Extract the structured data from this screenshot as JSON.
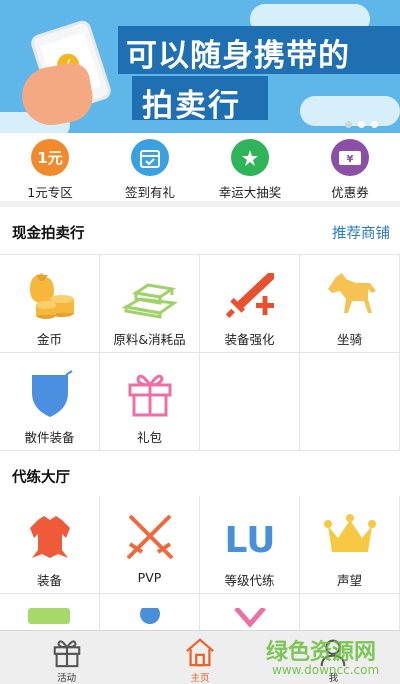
{
  "banner": {
    "headline_line1": "可以随身携带的",
    "headline_line2": "拍卖行",
    "page_dots": 3,
    "active_dot": 2
  },
  "quick_menu": [
    {
      "label": "1元专区",
      "icon": "one-yuan-icon",
      "icon_text": "1元",
      "color": "#f08a2c"
    },
    {
      "label": "签到有礼",
      "icon": "calendar-checkin-icon",
      "icon_text": "",
      "color": "#3aa0df"
    },
    {
      "label": "幸运大抽奖",
      "icon": "lucky-draw-icon",
      "icon_text": "",
      "color": "#2fb45a"
    },
    {
      "label": "优惠券",
      "icon": "coupon-icon",
      "icon_text": "",
      "color": "#8b4fa8"
    }
  ],
  "cash_auction": {
    "title": "现金拍卖行",
    "link": "推荐商铺",
    "items": [
      {
        "label": "金币",
        "icon": "gold-coins-icon"
      },
      {
        "label": "原料&消耗品",
        "icon": "gold-bars-icon"
      },
      {
        "label": "装备强化",
        "icon": "sword-plus-icon"
      },
      {
        "label": "坐骑",
        "icon": "horse-icon"
      },
      {
        "label": "散件装备",
        "icon": "shield-icon"
      },
      {
        "label": "礼包",
        "icon": "gift-box-icon"
      }
    ]
  },
  "leveling_hall": {
    "title": "代练大厅",
    "items": [
      {
        "label": "装备",
        "icon": "armor-icon"
      },
      {
        "label": "PVP",
        "icon": "crossed-swords-icon"
      },
      {
        "label": "等级代练",
        "icon": "level-up-icon",
        "icon_text": "LU"
      },
      {
        "label": "声望",
        "icon": "crown-icon"
      }
    ]
  },
  "bottom_nav": [
    {
      "label": "活动",
      "icon": "gift-icon",
      "active": false
    },
    {
      "label": "主页",
      "icon": "home-icon",
      "active": true
    },
    {
      "label": "我",
      "icon": "user-icon",
      "active": false
    }
  ],
  "watermark": {
    "line1": "绿色资源网",
    "line2": "www.downcc.com"
  }
}
